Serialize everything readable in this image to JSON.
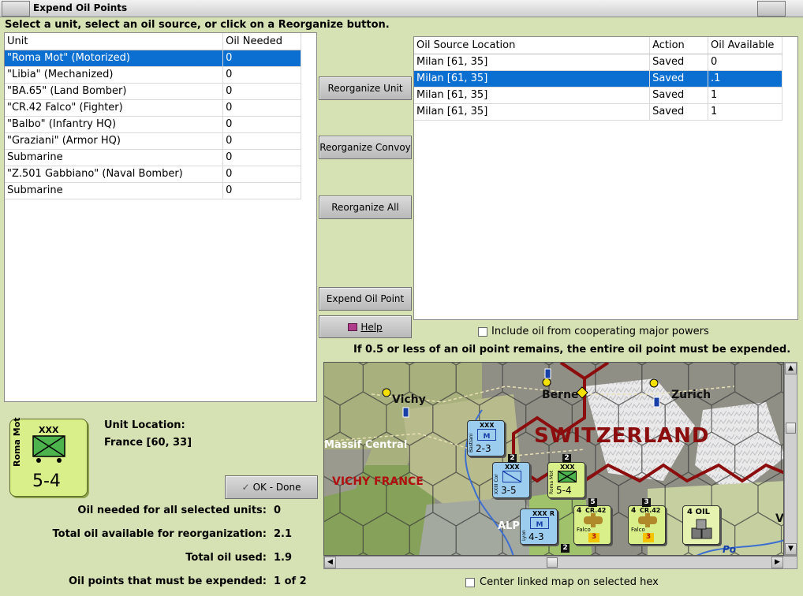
{
  "window": {
    "title": "Expend Oil Points"
  },
  "instruction": "Select a unit, select an oil source, or click on a Reorganize button.",
  "units_table": {
    "headers": [
      "Unit",
      "Oil Needed"
    ],
    "rows": [
      {
        "unit": "\"Roma Mot\" (Motorized)",
        "oil": "0",
        "selected": true
      },
      {
        "unit": "\"Libia\" (Mechanized)",
        "oil": "0"
      },
      {
        "unit": "\"BA.65\" (Land Bomber)",
        "oil": "0"
      },
      {
        "unit": "\"CR.42 Falco\" (Fighter)",
        "oil": "0"
      },
      {
        "unit": "\"Balbo\" (Infantry HQ)",
        "oil": "0"
      },
      {
        "unit": "\"Graziani\" (Armor HQ)",
        "oil": "0"
      },
      {
        "unit": "Submarine",
        "oil": "0"
      },
      {
        "unit": "\"Z.501 Gabbiano\" (Naval Bomber)",
        "oil": "0"
      },
      {
        "unit": "Submarine",
        "oil": "0"
      }
    ]
  },
  "buttons": {
    "reorganize_unit": "Reorganize Unit",
    "reorganize_convoy": "Reorganize Convoy",
    "reorganize_all": "Reorganize All",
    "expend_oil_point": "Expend Oil Point",
    "help": "Help",
    "ok_done": "OK - Done"
  },
  "oil_table": {
    "headers": [
      "Oil Source Location",
      "Action",
      "Oil Available"
    ],
    "rows": [
      {
        "loc": "Milan [61, 35]",
        "action": "Saved",
        "avail": "0"
      },
      {
        "loc": "Milan [61, 35]",
        "action": "Saved",
        "avail": ".1",
        "selected": true
      },
      {
        "loc": "Milan [61, 35]",
        "action": "Saved",
        "avail": "1"
      },
      {
        "loc": "Milan [61, 35]",
        "action": "Saved",
        "avail": "1"
      }
    ]
  },
  "include_coop_label": "Include oil from cooperating major powers",
  "expend_rule": "If 0.5 or less of an oil point remains, the entire oil point must be expended.",
  "unit_counter": {
    "name": "Roma Mot",
    "size": "XXX",
    "strength": "5-4"
  },
  "unit_location_label": "Unit Location:",
  "unit_location_value": "France [60, 33]",
  "stats": [
    {
      "label": "Oil needed for all selected units:",
      "value": "0"
    },
    {
      "label": "Total oil available for reorganization:",
      "value": "2.1"
    },
    {
      "label": "Total oil used:",
      "value": "1.9"
    },
    {
      "label": "Oil points that must be expended:",
      "value": "1 of 2"
    }
  ],
  "center_map_label": "Center linked map on selected hex",
  "map": {
    "labels": {
      "vichy": "Vichy",
      "berne": "Berne",
      "zurich": "Zurich",
      "switzerland": "SWITZERLAND",
      "massif": "Massif Central",
      "vichy_france": "VICHY FRANCE",
      "alps": "ALPS",
      "po": "Po",
      "edge_v": "V"
    },
    "counters": [
      {
        "size": "XXX",
        "type": "M",
        "strength": "2-3",
        "side": "Bastiani"
      },
      {
        "size": "XXX",
        "type": "inf",
        "strength": "3-5",
        "side": "XXIII Cor"
      },
      {
        "size": "XXX",
        "type": "mech",
        "strength": "5-4",
        "side": "Roma Mot"
      },
      {
        "size": "XXX",
        "type": "M",
        "strength": "4-3",
        "side": "Lyon",
        "tag": "R"
      },
      {
        "title": "CR.42",
        "pre": "4",
        "sub": "Falco",
        "strength": "3"
      },
      {
        "title": "CR.42",
        "pre": "4",
        "sub": "Falco",
        "strength": "3"
      },
      {
        "title": "4 OIL"
      }
    ],
    "stack_counts": [
      "2",
      "2",
      "5",
      "3",
      "2"
    ]
  },
  "colors": {
    "background": "#d7e2b4",
    "selection": "#0a6fd0",
    "counter_green": "#d9f08a",
    "counter_blue": "#9ccdef",
    "border_red": "#8b0d0d"
  }
}
